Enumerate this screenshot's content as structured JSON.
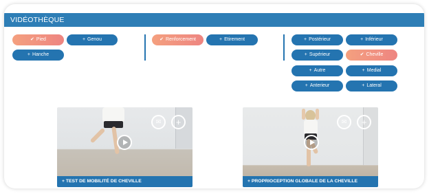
{
  "section_title": "VIDÉOTHÈQUE",
  "filters": {
    "body_parts": [
      {
        "label": "Pied",
        "icon": "✔",
        "active": true
      },
      {
        "label": "Genou",
        "icon": "+",
        "active": false
      },
      {
        "label": "Hanche",
        "icon": "+",
        "active": false
      }
    ],
    "exercise_types": [
      {
        "label": "Renforcement",
        "icon": "✔",
        "active": true
      },
      {
        "label": "Etirement",
        "icon": "+",
        "active": false
      }
    ],
    "zones": [
      {
        "label": "Postérieur",
        "icon": "+",
        "active": false
      },
      {
        "label": "Inférieur",
        "icon": "+",
        "active": false
      },
      {
        "label": "Supérieur",
        "icon": "+",
        "active": false
      },
      {
        "label": "Cheville",
        "icon": "✔",
        "active": true
      },
      {
        "label": "Autre",
        "icon": "+",
        "active": false
      },
      {
        "label": "Medial",
        "icon": "+",
        "active": false
      },
      {
        "label": "Anterieur",
        "icon": "+",
        "active": false
      },
      {
        "label": "Lateral",
        "icon": "+",
        "active": false
      }
    ]
  },
  "videos": [
    {
      "caption": "+ TEST DE MOBILITÉ DE CHEVILLE",
      "mail_icon": "✉",
      "add_icon": "+"
    },
    {
      "caption": "+ PROPRIOCEPTION GLOBALE DE LA CHEVILLE",
      "mail_icon": "✉",
      "add_icon": "+"
    }
  ],
  "colors": {
    "primary": "#2474b0",
    "title_bar": "#2e7eb6",
    "active_gradient_start": "#f4a07f",
    "active_gradient_end": "#ee8581"
  }
}
